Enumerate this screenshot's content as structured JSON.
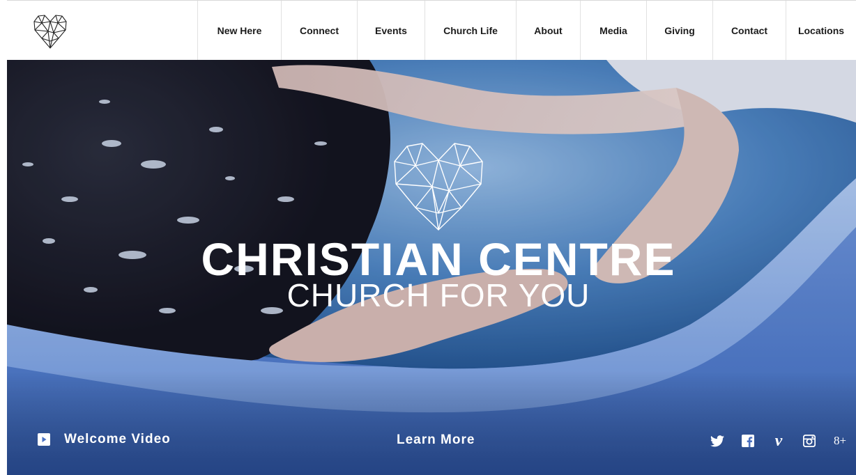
{
  "header": {
    "nav": [
      {
        "label": "New Here"
      },
      {
        "label": "Connect"
      },
      {
        "label": "Events"
      },
      {
        "label": "Church Life"
      },
      {
        "label": "About"
      },
      {
        "label": "Media"
      },
      {
        "label": "Giving"
      },
      {
        "label": "Contact"
      },
      {
        "label": "Locations"
      }
    ]
  },
  "hero": {
    "title": "CHRISTIAN CENTRE",
    "subtitle": "CHURCH FOR YOU",
    "welcome_video_label": "Welcome Video",
    "learn_more_label": "Learn More",
    "social": [
      {
        "icon": "twitter-icon"
      },
      {
        "icon": "facebook-icon"
      },
      {
        "icon": "vimeo-icon",
        "glyph": "v"
      },
      {
        "icon": "instagram-icon"
      },
      {
        "icon": "google-plus-icon",
        "glyph": "8+"
      }
    ]
  },
  "colors": {
    "nav_text": "#1b1b1b",
    "hero_text": "#ffffff",
    "pool_blue": "#6f95da",
    "water_blue": "#3f6fb0"
  }
}
